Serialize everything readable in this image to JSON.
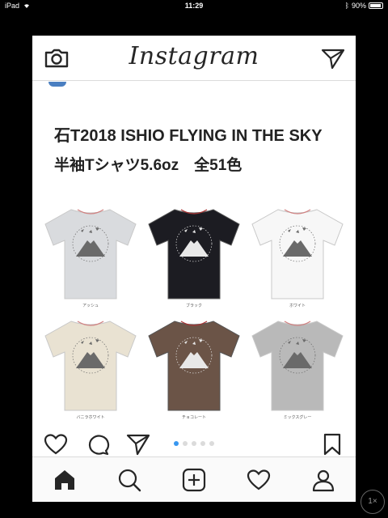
{
  "status": {
    "device": "iPad",
    "time": "11:29",
    "battery": "90%"
  },
  "app": {
    "logo": "Instagram"
  },
  "post": {
    "title_line1": "石T2018 ISHIO FLYING IN THE SKY",
    "title_line2": "半袖Tシャツ5.6oz　全51色",
    "shirts": [
      {
        "color": "#d9dbde",
        "label": "アッシュ"
      },
      {
        "color": "#1c1c22",
        "label": "ブラック"
      },
      {
        "color": "#f7f7f7",
        "label": "ホワイト"
      },
      {
        "color": "#e9e2d2",
        "label": "バニラホワイト"
      },
      {
        "color": "#6b5447",
        "label": "チョコレート"
      },
      {
        "color": "#b9b9b9",
        "label": "ミックスグレー"
      }
    ],
    "carousel": {
      "count": 5,
      "active": 0
    }
  },
  "icons": {
    "camera": "camera-icon",
    "direct": "direct-message-icon",
    "like": "heart-icon",
    "comment": "comment-icon",
    "share": "share-icon",
    "save": "bookmark-icon",
    "home": "home-icon",
    "search": "search-icon",
    "add": "add-post-icon",
    "activity": "activity-heart-icon",
    "profile": "profile-icon"
  },
  "zoom": "1×"
}
